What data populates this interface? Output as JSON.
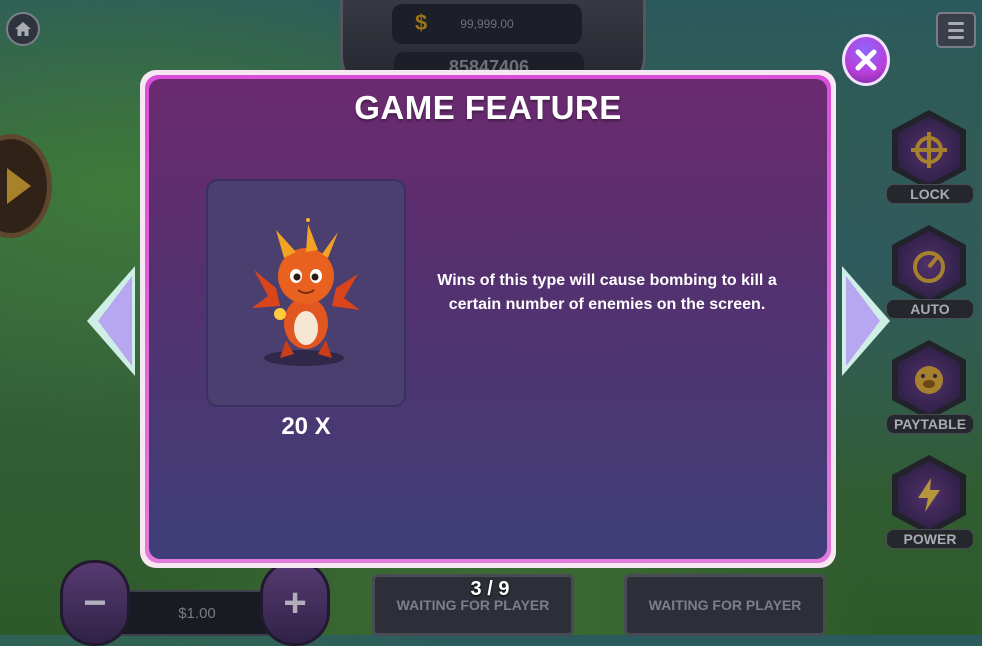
{
  "hud": {
    "balance": "99,999.00",
    "player_id": "85847406",
    "bet_value": "$1.00"
  },
  "side_buttons": [
    {
      "label": "LOCK",
      "icon": "crosshair-icon"
    },
    {
      "label": "AUTO",
      "icon": "auto-gauge-icon"
    },
    {
      "label": "PAYTABLE",
      "icon": "pig-icon"
    },
    {
      "label": "POWER",
      "icon": "lightning-icon"
    }
  ],
  "seats": {
    "seat1": "WAITING FOR PLAYER",
    "seat2": "WAITING FOR PLAYER"
  },
  "dialog": {
    "title": "GAME FEATURE",
    "multiplier": "20 X",
    "description": "Wins of this type will cause bombing to kill a certain number of enemies on the screen.",
    "page": "3 / 9"
  },
  "colors": {
    "panel_border": "#e37ad9",
    "panel_top": "#6b2a6f",
    "panel_bottom": "#3e3f78",
    "arrow": "#cfeee6"
  }
}
